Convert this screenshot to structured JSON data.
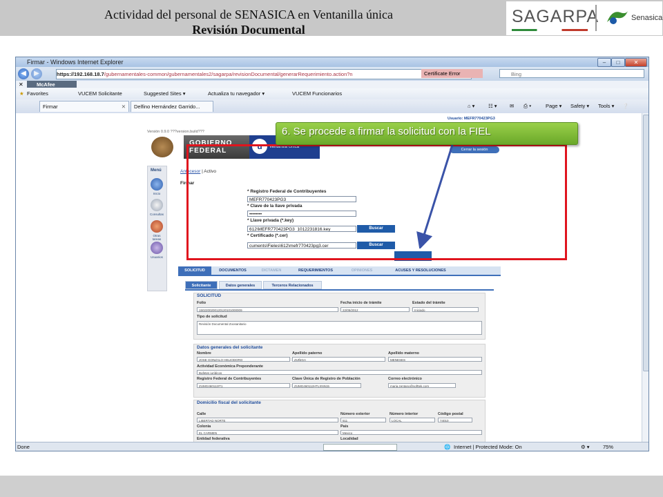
{
  "slide": {
    "title_line1": "Actividad del personal de SENASICA en Ventanilla  única",
    "title_line2": "Revisión Documental",
    "logo_sagarpa": "SAGARPA",
    "logo_senasica": "Senasica"
  },
  "browser": {
    "window_title": "Firmar - Windows Internet Explorer",
    "url_host": "https://192.168.18.7",
    "url_path": "/gubernamentales-common/gubernamentales2/sagarpa/revisionDocumental/generarRequerimiento.action?n",
    "cert_error": "Certificate Error",
    "search_placeholder": "Bing",
    "mcafee": "McAfee",
    "favorites": "Favorites",
    "fav_items": [
      "VUCEM Solicitante",
      "Suggested Sites ▾",
      "Actualiza tu navegador ▾",
      "VUCEM Funcionarios"
    ],
    "tabs": [
      "Firmar",
      "Delfino Hernández Garrido..."
    ],
    "command_items": [
      "Page ▾",
      "Safety ▾",
      "Tools ▾"
    ],
    "status_left": "Done",
    "status_zone": "Internet | Protected Mode: On",
    "status_zoom": "75%"
  },
  "app": {
    "usuario": "Usuario: MEFR770423PG3",
    "version": "Versión 0.9.0 ???version.build???",
    "gobierno": "GOBIERNO FEDERAL",
    "vu_text": "Ventanilla Única",
    "cerrar_sesion": "Cerrar la sesión",
    "menu_title": "Menú",
    "menu_items": [
      "Inicio",
      "Consultas",
      "Otras tareas",
      "Usuarios"
    ],
    "breadcrumb_link": "Antecesor",
    "breadcrumb_sep": "|",
    "breadcrumb_current": "Activo",
    "form_title": "Firmar",
    "rfc_label": "* Registro Federal de Contribuyentes",
    "rfc_value": "MEFR770423PG3",
    "clave_label": "* Clave de la llave privada",
    "clave_value": "••••••••",
    "key_label": "* Llave privada (*.key)",
    "key_value": "612\\MEFR770423PG3_1012231816.key",
    "cer_label": "* Certificado (*.cer)",
    "cer_value": "cuments\\Fieles\\612\\mefr770423pg3.cer",
    "buscar": "Buscar",
    "main_tabs": [
      "SOLICITUD",
      "DOCUMENTOS",
      "DICTAMEN",
      "REQUERIMIENTOS",
      "OPINIONES",
      "ACUSES Y RESOLUCIONES"
    ],
    "sub_tabs": [
      "Solicitante",
      "Datos generales",
      "Terceros Relacionados"
    ],
    "solicitud": {
      "title": "SOLICITUD",
      "folio_label": "Folio",
      "folio": "1502200200120120101000009",
      "fecha_label": "Fecha inicio de trámite",
      "fecha": "22/05/2012",
      "estado_label": "Estado del trámite",
      "estado": "Iniciado",
      "tipo_label": "Tipo de solicitud",
      "tipo": "Revisión Documental Zoosanitario"
    },
    "datos_generales": {
      "title": "Datos generales del solicitante",
      "nombre_label": "Nombre",
      "nombre": "JOSE GONZALO HELIODORO",
      "paterno_label": "Apellido paterno",
      "paterno": "ZUÑIGA",
      "materno_label": "Apellido materno",
      "materno": "MENESES",
      "actividad_label": "Actividad Económica Preponderante",
      "actividad": "Bufetes jurídicos",
      "rfc_label": "Registro Federal de Contribuyentes",
      "rfc": "ZUMG460112IT1",
      "curp_label": "Clave Única de Registro de Población",
      "curp": "ZUMG460112HTLXNN15",
      "correo_label": "Correo electrónico",
      "correo": "maria.zentano@softtek.com"
    },
    "domicilio": {
      "title": "Domicilio fiscal del solicitante",
      "calle_label": "Calle",
      "calle": "LIBERTAD NORTE",
      "ext_label": "Número exterior",
      "ext": "511",
      "int_label": "Número interior",
      "int": "LOCAL",
      "cp_label": "Código postal",
      "cp": "74010",
      "colonia_label": "Colonia",
      "colonia": "EL CARMEN",
      "pais_label": "País",
      "pais": "Mexico",
      "entidad_label": "Entidad federativa",
      "localidad_label": "Localidad"
    }
  },
  "annotation": {
    "callout": "6. Se procede a firmar la solicitud con la FIEL"
  }
}
